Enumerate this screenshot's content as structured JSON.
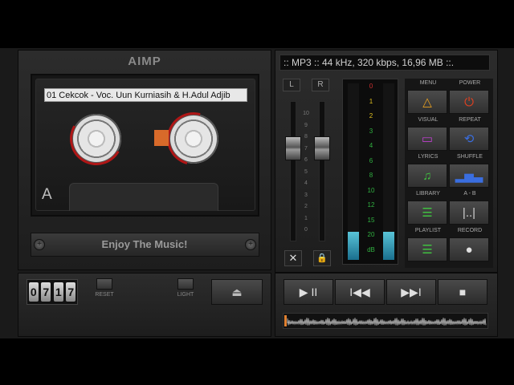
{
  "app": {
    "logo": "AIMP"
  },
  "cassette": {
    "track_label": "01 Cekcok - Voc. Uun Kurniasih & H.Adul Adjib",
    "side": "A",
    "slogan": "Enjoy The Music!"
  },
  "counter": {
    "digits": [
      "0",
      "7",
      "1",
      "7"
    ]
  },
  "deck_buttons": {
    "reset": "RESET",
    "light": "LIGHT",
    "eject": "⏏"
  },
  "info": {
    "text": ":: MP3 :: 44 kHz, 320 kbps, 16,96 MB ::."
  },
  "channels": {
    "left": "L",
    "right": "R"
  },
  "slider_scale": [
    "10",
    "9",
    "8",
    "7",
    "6",
    "5",
    "4",
    "3",
    "2",
    "1",
    "0"
  ],
  "slider_icons": {
    "mute": "✕",
    "lock": "🔒"
  },
  "vu_scale": [
    "0",
    "1",
    "2",
    "3",
    "4",
    "6",
    "8",
    "10",
    "12",
    "15",
    "20",
    "dB"
  ],
  "vu_levels": {
    "left": 0.16,
    "right": 0.16
  },
  "grid": [
    {
      "label": "MENU",
      "icon": "triangle-icon",
      "glyph": "△",
      "color": "#e8a020"
    },
    {
      "label": "POWER",
      "icon": "power-icon",
      "glyph": "⏻",
      "color": "#e04020"
    },
    {
      "label": "VISUAL",
      "icon": "monitor-icon",
      "glyph": "▭",
      "color": "#c040d0"
    },
    {
      "label": "REPEAT",
      "icon": "repeat-icon",
      "glyph": "⟲",
      "color": "#3a6ee0"
    },
    {
      "label": "LYRICS",
      "icon": "lyrics-icon",
      "glyph": "♫",
      "color": "#40c040"
    },
    {
      "label": "SHUFFLE",
      "icon": "equalizer-icon",
      "glyph": "▂▅▃",
      "color": "#3a6ee0"
    },
    {
      "label": "LIBRARY",
      "icon": "list-icon",
      "glyph": "☰",
      "color": "#40c040"
    },
    {
      "label": "A - B",
      "icon": "ab-loop-icon",
      "glyph": "|..|",
      "color": "#d0d0d0"
    },
    {
      "label": "PLAYLIST",
      "icon": "playlist-icon",
      "glyph": "☰",
      "color": "#40c040"
    },
    {
      "label": "RECORD",
      "icon": "record-icon",
      "glyph": "●",
      "color": "#e0e0e0"
    }
  ],
  "transport": {
    "play_pause": "▶ II",
    "prev": "I◀◀",
    "next": "▶▶I",
    "stop": "■"
  }
}
